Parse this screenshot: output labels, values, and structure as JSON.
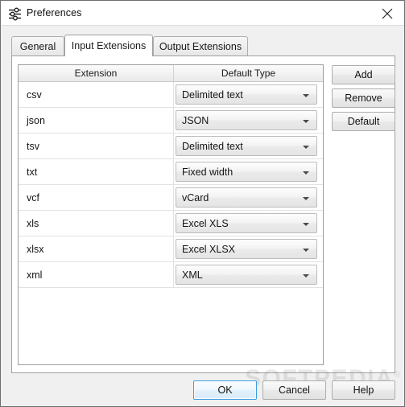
{
  "window": {
    "title": "Preferences",
    "title_icon": "sliders-settings-icon",
    "close_icon": "close-icon",
    "border_color": "#6e6e6e",
    "background": "#f0f0f0"
  },
  "tabs": [
    {
      "label": "General",
      "active": false
    },
    {
      "label": "Input Extensions",
      "active": true
    },
    {
      "label": "Output Extensions",
      "active": false
    }
  ],
  "table": {
    "columns": [
      "Extension",
      "Default Type"
    ],
    "rows": [
      {
        "extension": "csv",
        "default_type": "Delimited text"
      },
      {
        "extension": "json",
        "default_type": "JSON"
      },
      {
        "extension": "tsv",
        "default_type": "Delimited text"
      },
      {
        "extension": "txt",
        "default_type": "Fixed width"
      },
      {
        "extension": "vcf",
        "default_type": "vCard"
      },
      {
        "extension": "xls",
        "default_type": "Excel XLS"
      },
      {
        "extension": "xlsx",
        "default_type": "Excel XLSX"
      },
      {
        "extension": "xml",
        "default_type": "XML"
      }
    ]
  },
  "side_buttons": [
    {
      "label": "Add"
    },
    {
      "label": "Remove"
    },
    {
      "label": "Default"
    }
  ],
  "bottom_buttons": [
    {
      "label": "OK",
      "default": true
    },
    {
      "label": "Cancel",
      "default": false
    },
    {
      "label": "Help",
      "default": false
    }
  ],
  "watermark": {
    "text": "SOFTPEDIA",
    "mark": "®"
  }
}
